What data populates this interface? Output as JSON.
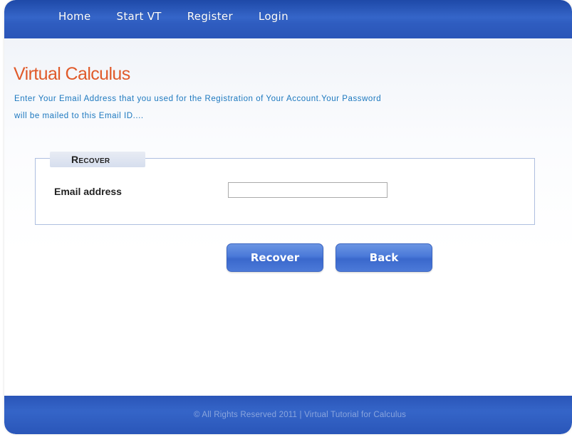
{
  "nav": {
    "items": [
      {
        "label": "Home"
      },
      {
        "label": "Start VT"
      },
      {
        "label": "Register"
      },
      {
        "label": "Login"
      }
    ]
  },
  "page": {
    "title": "Virtual Calculus",
    "instructions_line1": "Enter Your Email Address that you used for the Registration of Your Account.Your Password",
    "instructions_line2": "will be mailed to this Email ID...."
  },
  "form": {
    "legend": "Recover",
    "email_label": "Email address",
    "email_value": ""
  },
  "buttons": {
    "recover_label": "Recover",
    "back_label": "Back"
  },
  "footer": {
    "text": "© All Rights Reserved 2011 | Virtual Tutorial for Calculus"
  },
  "colors": {
    "nav_blue": "#2f5dc0",
    "title_orange": "#e05a2a",
    "instruction_blue": "#1c78bf",
    "button_blue": "#4a79d8"
  }
}
